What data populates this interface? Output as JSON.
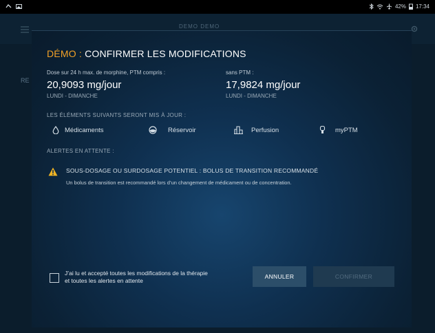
{
  "status_bar": {
    "battery": "42%",
    "time": "17:34"
  },
  "background": {
    "header_title": "DEMO DEMO",
    "side_label": "RE"
  },
  "dialog": {
    "title_demo": "DÉMO",
    "title_sep": " : ",
    "title_text": "CONFIRMER LES MODIFICATIONS",
    "dose_with_ptm": {
      "label": "Dose sur 24 h max. de morphine, PTM compris :",
      "value": "20,9093 mg/jour",
      "days": "LUNDI - DIMANCHE"
    },
    "dose_without_ptm": {
      "label": "sans PTM :",
      "value": "17,9824 mg/jour",
      "days": "LUNDI - DIMANCHE"
    },
    "updates_heading": "LES ÉLÉMENTS SUIVANTS SERONT MIS À JOUR :",
    "update_items": [
      {
        "label": "Médicaments",
        "icon": "drop-icon"
      },
      {
        "label": "Réservoir",
        "icon": "reservoir-icon"
      },
      {
        "label": "Perfusion",
        "icon": "infusion-chart-icon"
      },
      {
        "label": "myPTM",
        "icon": "hand-pump-icon"
      }
    ],
    "alerts_heading": "ALERTES EN ATTENTE :",
    "alert": {
      "icon": "warning-icon",
      "title": "SOUS-DOSAGE OU SURDOSAGE POTENTIEL : BOLUS DE TRANSITION RECOMMANDÉ",
      "description": "Un bolus de transition est recommandé lors d’un changement de médicament ou de concentration."
    },
    "acknowledge_line1": "J’ai lu et accepté toutes les modifications de la thérapie",
    "acknowledge_line2": "et toutes les alertes en attente",
    "cancel_label": "ANNULER",
    "confirm_label": "CONFIRMER"
  },
  "colors": {
    "accent_orange": "#f2a127",
    "warning_yellow": "#f0b323",
    "cancel_button": "#2c4e69",
    "confirm_disabled": "#1f3a50"
  }
}
